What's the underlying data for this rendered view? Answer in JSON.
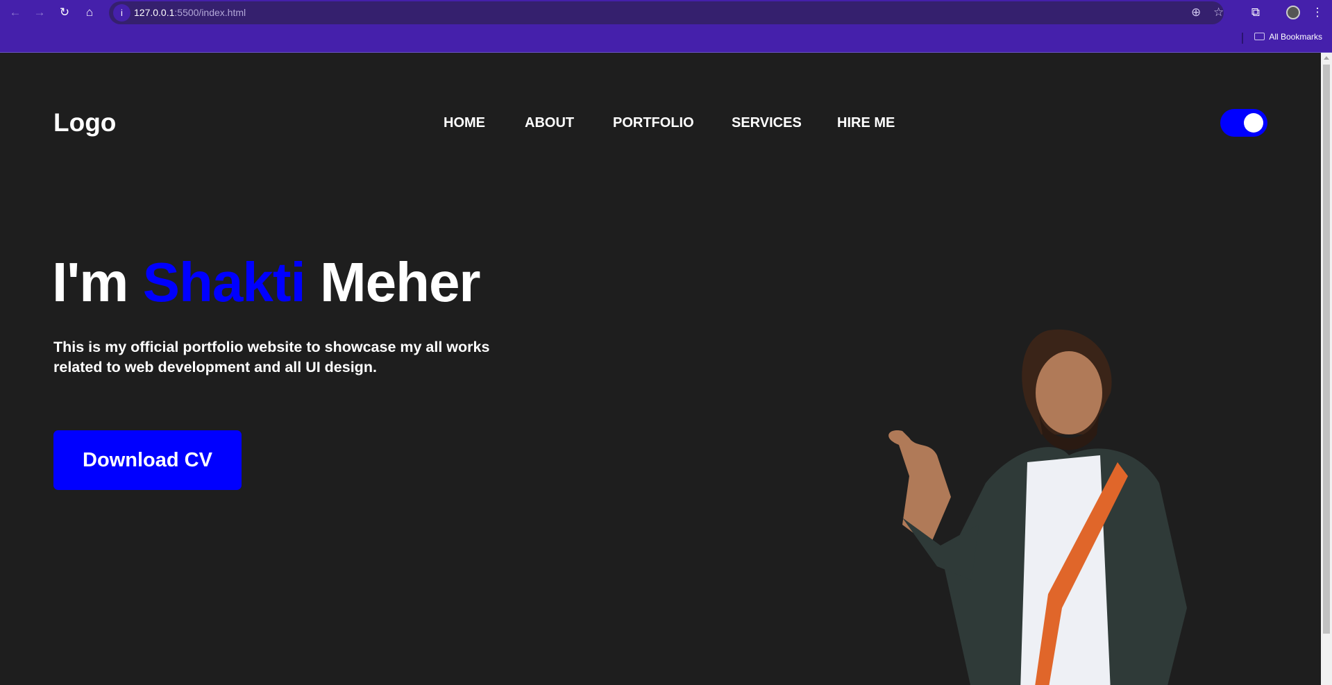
{
  "browser": {
    "url_host": "127.0.0.1",
    "url_rest": ":5500/index.html",
    "bookmarks_label": "All Bookmarks"
  },
  "header": {
    "logo": "Logo",
    "nav": [
      "HOME",
      "ABOUT",
      "PORTFOLIO",
      "SERVICES",
      "HIRE ME"
    ],
    "theme_toggle_on": true
  },
  "hero": {
    "greeting": "I'm",
    "first_name": "Shakti",
    "last_name": "Meher",
    "description": "This is my official portfolio website to showcase my all works related to web development and all UI design.",
    "cta": "Download CV"
  },
  "colors": {
    "accent": "#0000ff",
    "background": "#1e1e1e",
    "browser_frame": "#4520ab"
  }
}
